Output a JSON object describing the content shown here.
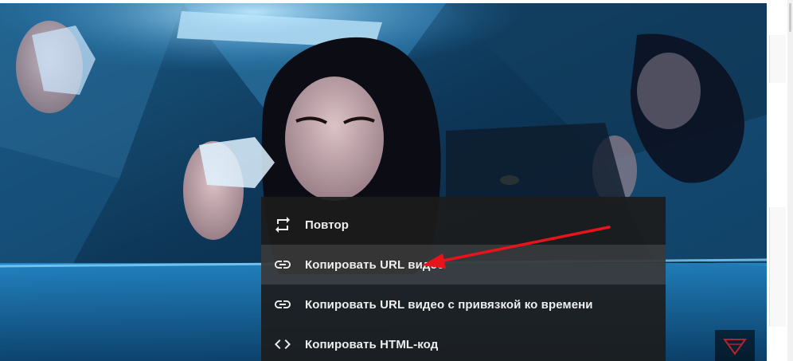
{
  "context_menu": {
    "items": [
      {
        "icon": "loop-icon",
        "label": "Повтор"
      },
      {
        "icon": "link-icon",
        "label": "Копировать URL видео"
      },
      {
        "icon": "link-icon",
        "label": "Копировать URL видео с привязкой ко времени"
      },
      {
        "icon": "code-icon",
        "label": "Копировать HTML-код"
      }
    ],
    "highlighted_index": 1
  },
  "colors": {
    "menu_background": "#1c1c1c",
    "menu_text": "#eeeeee",
    "annotation_arrow": "#e8141b",
    "video_tint": "#1a8fd6"
  }
}
